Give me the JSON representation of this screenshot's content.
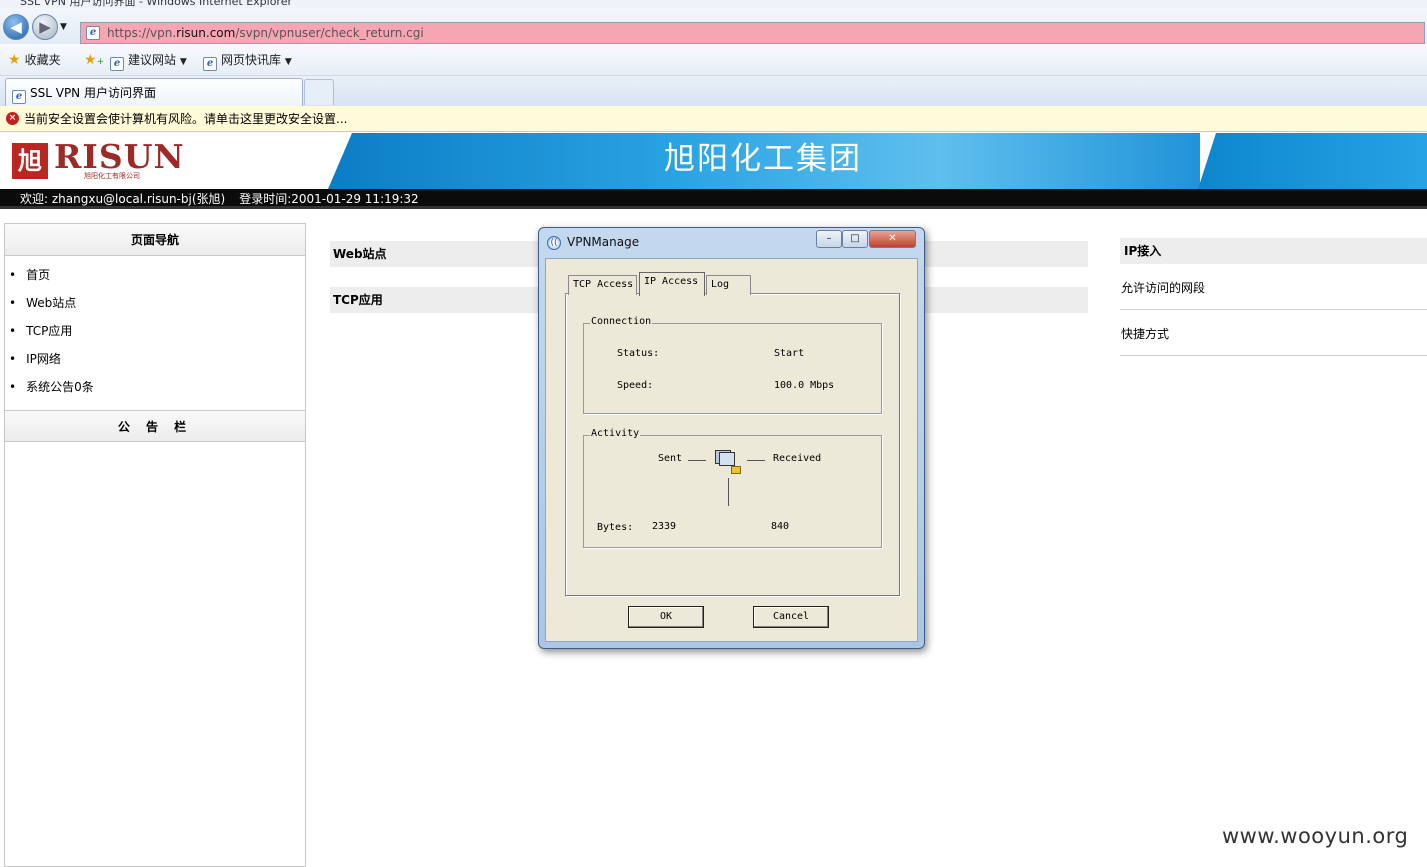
{
  "window": {
    "title": "SSL VPN 用户访问界面 - Windows Internet Explorer"
  },
  "browser": {
    "address_prefix": "https://vpn.",
    "address_host": "risun.com",
    "address_path": "/svpn/vpnuser/check_return.cgi",
    "favorites_label": "收藏夹",
    "suggested_sites": "建议网站",
    "web_slice": "网页快讯库",
    "tab_title": "SSL VPN 用户访问界面",
    "security_warning": "当前安全设置会使计算机有风险。请单击这里更改安全设置..."
  },
  "banner": {
    "logo_text": "RISUN",
    "logo_sub": "旭阳化工有限公司",
    "title": "旭阳化工集团"
  },
  "welcome": {
    "greeting": "欢迎: zhangxu@local.risun-bj(张旭)",
    "login_time": "登录时间:2001-01-29 11:19:32"
  },
  "leftnav": {
    "header": "页面导航",
    "items": [
      "首页",
      "Web站点",
      "TCP应用",
      "IP网络",
      "系统公告0条"
    ],
    "board_header": "公 告 栏"
  },
  "main": {
    "web_sites": "Web站点",
    "tcp_apps": "TCP应用"
  },
  "right": {
    "ip_access": "IP接入",
    "allowed_segments": "允许访问的网段",
    "shortcuts": "快捷方式"
  },
  "dialog": {
    "title": "VPNManage",
    "tabs": [
      "TCP Access",
      "IP Access",
      "Log"
    ],
    "connection": {
      "label": "Connection",
      "status_label": "Status:",
      "status_value": "Start",
      "speed_label": "Speed:",
      "speed_value": "100.0 Mbps"
    },
    "activity": {
      "label": "Activity",
      "sent": "Sent",
      "received": "Received",
      "bytes_label": "Bytes:",
      "bytes_sent": "2339",
      "bytes_received": "840"
    },
    "ok": "OK",
    "cancel": "Cancel"
  },
  "watermark": "www.wooyun.org"
}
